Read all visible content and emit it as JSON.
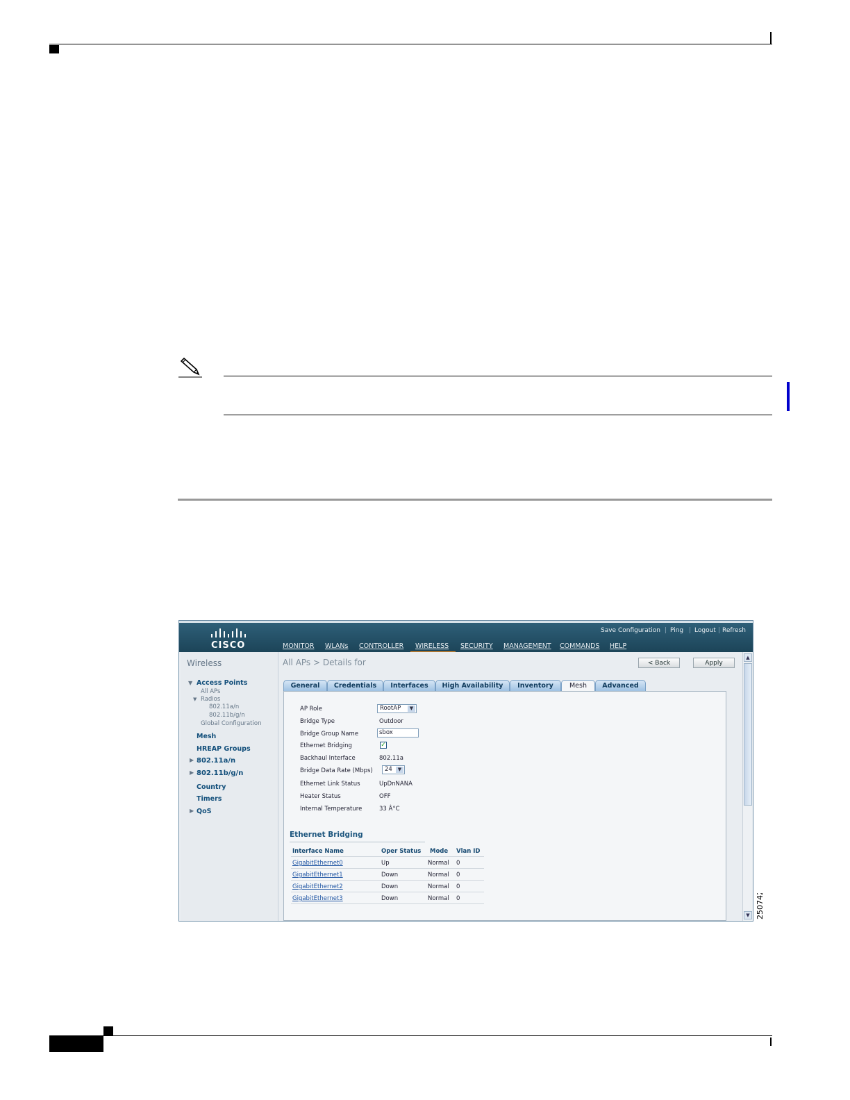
{
  "figure": {
    "number": "250742"
  },
  "app": {
    "logo_text": "CISCO",
    "top_links": [
      "Save Configuration",
      "Ping",
      "Logout",
      "Refresh"
    ],
    "nav": [
      "MONITOR",
      "WLANs",
      "CONTROLLER",
      "WIRELESS",
      "SECURITY",
      "MANAGEMENT",
      "COMMANDS",
      "HELP"
    ],
    "active_nav": "WIRELESS",
    "colors": {
      "topbar": "#1c4458",
      "active_nav_bar": "#f08a1c",
      "link": "#114e7a",
      "tab": "#9fc2e3"
    }
  },
  "sidebar": {
    "title": "Wireless",
    "access_points": "Access Points",
    "all_aps": "All APs",
    "radios": "Radios",
    "radio_80211an": "802.11a/n",
    "radio_80211bgn": "802.11b/g/n",
    "global_configuration": "Global Configuration",
    "mesh": "Mesh",
    "hreap_groups": "HREAP Groups",
    "net_80211an": "802.11a/n",
    "net_80211bgn": "802.11b/g/n",
    "country": "Country",
    "timers": "Timers",
    "qos": "QoS"
  },
  "page": {
    "title": "All APs > Details for",
    "back_button": "< Back",
    "apply_button": "Apply"
  },
  "tabs": [
    "General",
    "Credentials",
    "Interfaces",
    "High Availability",
    "Inventory",
    "Mesh",
    "Advanced"
  ],
  "active_tab": "Mesh",
  "fields": {
    "ap_role": {
      "label": "AP Role",
      "value": "RootAP"
    },
    "bridge_type": {
      "label": "Bridge Type",
      "value": "Outdoor"
    },
    "bridge_group_name": {
      "label": "Bridge Group Name",
      "value": "sbox"
    },
    "ethernet_bridging": {
      "label": "Ethernet Bridging",
      "checked": true
    },
    "backhaul_interface": {
      "label": "Backhaul Interface",
      "value": "802.11a"
    },
    "bridge_data_rate": {
      "label": "Bridge Data Rate (Mbps)",
      "value": "24"
    },
    "ethernet_link_status": {
      "label": "Ethernet Link Status",
      "value": "UpDnNANA"
    },
    "heater_status": {
      "label": "Heater Status",
      "value": "OFF"
    },
    "internal_temperature": {
      "label": "Internal Temperature",
      "value": "33 Â°C"
    }
  },
  "ethernet_bridging": {
    "heading": "Ethernet Bridging",
    "columns": [
      "Interface Name",
      "Oper Status",
      "Mode",
      "Vlan ID"
    ],
    "rows": [
      [
        "GigabitEthernet0",
        "Up",
        "Normal",
        "0"
      ],
      [
        "GigabitEthernet1",
        "Down",
        "Normal",
        "0"
      ],
      [
        "GigabitEthernet2",
        "Down",
        "Normal",
        "0"
      ],
      [
        "GigabitEthernet3",
        "Down",
        "Normal",
        "0"
      ]
    ]
  }
}
